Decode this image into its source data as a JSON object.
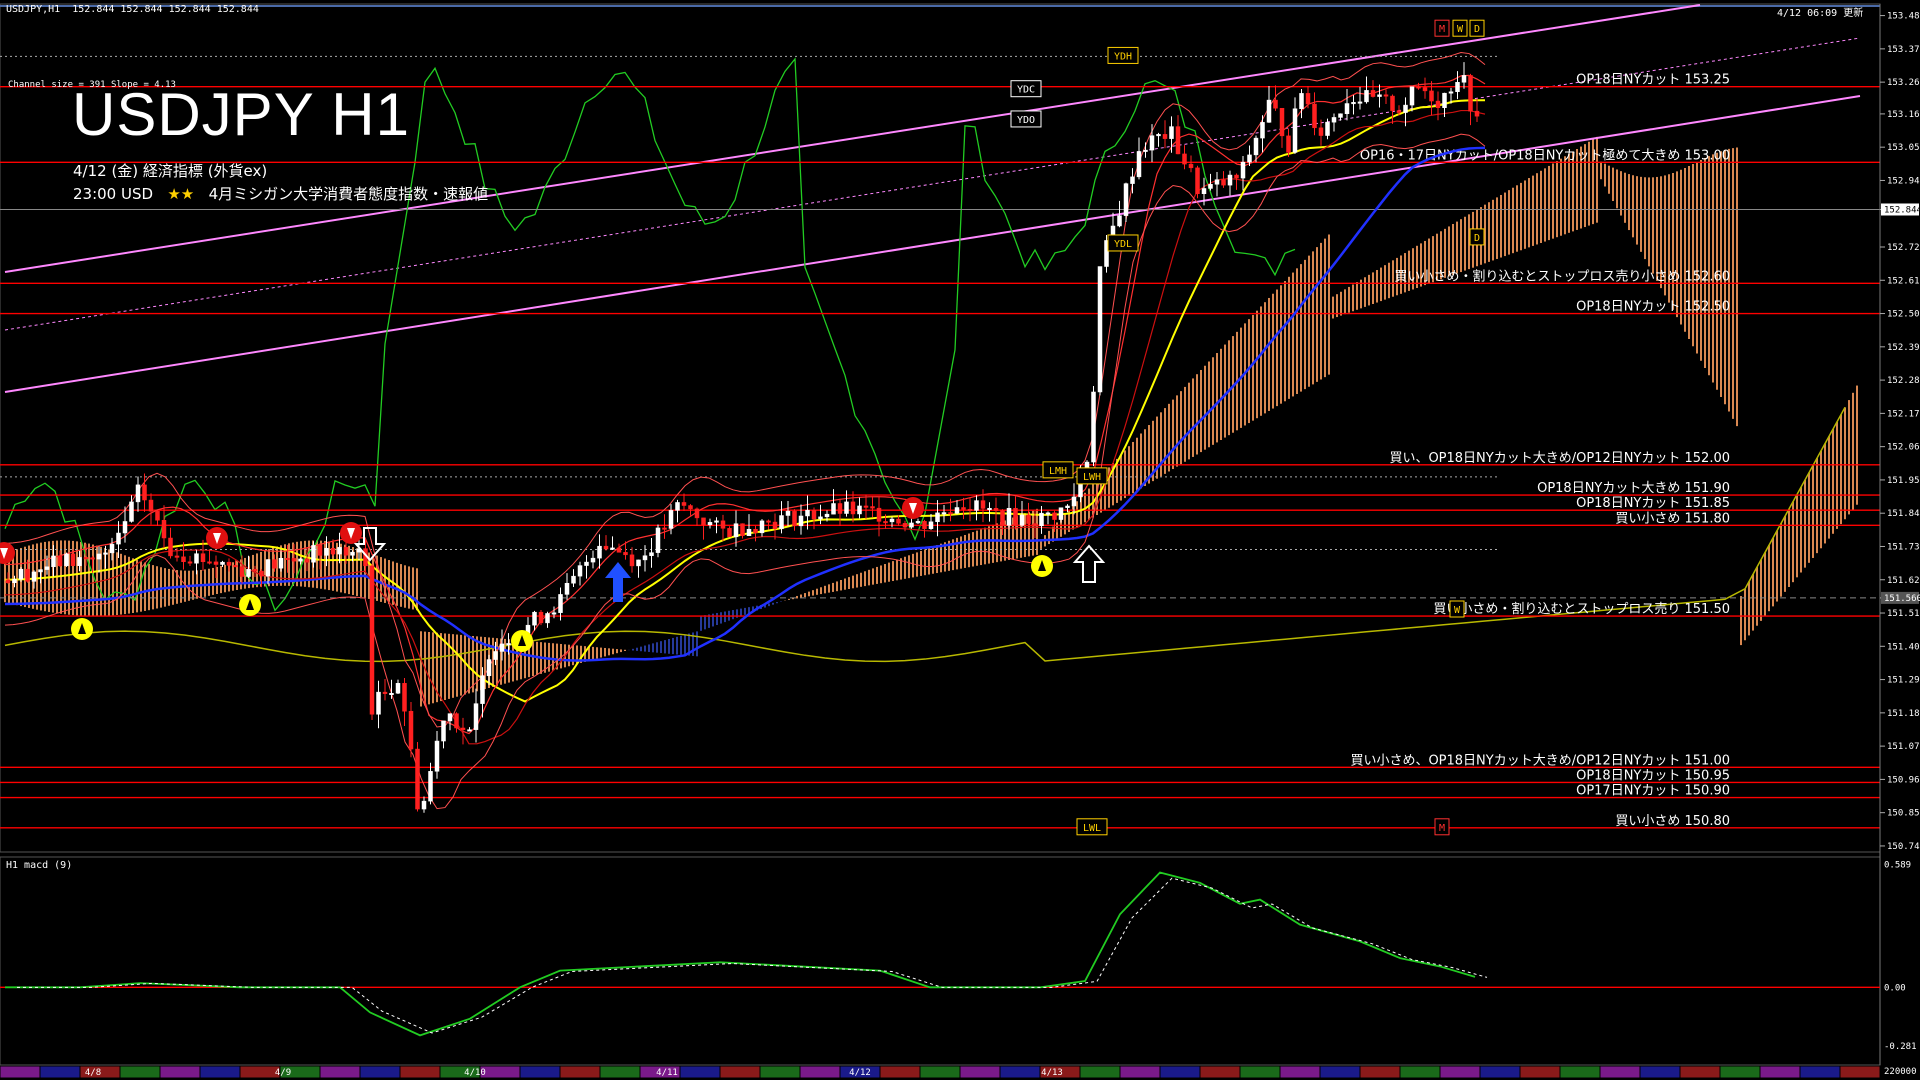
{
  "window_title": "USDJPY,H1",
  "ohlc_readout": "152.844 152.844 152.844 152.844",
  "update_stamp": "4/12 06:09 更新",
  "channel_info": "Channel size = 391 Slope = 4.13",
  "big_title": "USDJPY H1",
  "event_line1": "4/12 (金) 経済指標 (外貨ex)",
  "event_time": "23:00 USD",
  "event_stars": "★★",
  "event_desc": "4月ミシガン大学消費者態度指数・速報値",
  "macd_label": "H1  macd (9)",
  "current_price_tag": "152.844",
  "ask_price_tag": "151.560",
  "colors": {
    "bull_candle": "#ffffff",
    "bear_candle": "#ff2020",
    "level_line": "#ff0000",
    "channel": "#ff88ff",
    "kumo_up": "#ffa060",
    "kumo_down": "#4060ff",
    "ma_yellow": "#ffff00",
    "ma_blue": "#2030ff",
    "green_line": "#22cc22"
  },
  "chart_data": {
    "type": "candlestick",
    "symbol": "USDJPY",
    "timeframe": "H1",
    "y_axis_ticks": [
      "153.485",
      "153.375",
      "153.265",
      "153.160",
      "153.050",
      "152.940",
      "152.844",
      "152.720",
      "152.610",
      "152.500",
      "152.390",
      "152.280",
      "152.170",
      "152.060",
      "151.950",
      "151.840",
      "151.730",
      "151.620",
      "151.560",
      "151.510",
      "151.400",
      "151.290",
      "151.180",
      "151.070",
      "150.960",
      "150.850",
      "150.740"
    ],
    "ylim": [
      150.72,
      153.52
    ],
    "x_date_labels": [
      "4/8",
      "4/9",
      "4/10",
      "4/11",
      "4/12",
      "4/13"
    ],
    "price_levels": [
      {
        "price": 153.25,
        "label": "OP18日NYカット 153.25"
      },
      {
        "price": 153.0,
        "label": "OP16・17日NYカット/OP18日NYカット極めて大きめ 153.00"
      },
      {
        "price": 152.6,
        "label": "買い小さめ・割り込むとストップロス売り小さめ 152.60"
      },
      {
        "price": 152.5,
        "label": "OP18日NYカット 152.50"
      },
      {
        "price": 152.0,
        "label": "買い、OP18日NYカット大きめ/OP12日NYカット 152.00"
      },
      {
        "price": 151.9,
        "label": "OP18日NYカット大きめ 151.90"
      },
      {
        "price": 151.85,
        "label": "OP18日NYカット 151.85"
      },
      {
        "price": 151.8,
        "label": "買い小さめ 151.80"
      },
      {
        "price": 151.5,
        "label": "買い小さめ・割り込むとストップロス売り 151.50"
      },
      {
        "price": 151.0,
        "label": "買い小さめ、OP18日NYカット大きめ/OP12日NYカット 151.00"
      },
      {
        "price": 150.95,
        "label": "OP18日NYカット 150.95"
      },
      {
        "price": 150.9,
        "label": "OP17日NYカット 150.90"
      },
      {
        "price": 150.8,
        "label": "買い小さめ 150.80"
      }
    ],
    "markers": [
      {
        "label": "YDH",
        "price": 153.35
      },
      {
        "label": "YDC",
        "price": 153.24
      },
      {
        "label": "YDO",
        "price": 153.14
      },
      {
        "label": "YDL",
        "price": 152.73
      },
      {
        "label": "LMH",
        "price": 151.98
      },
      {
        "label": "LWH",
        "price": 151.96
      },
      {
        "label": "LWL",
        "price": 150.8
      },
      {
        "label": "M",
        "price": 153.44
      },
      {
        "label": "W",
        "price": 153.44
      },
      {
        "label": "D",
        "price": 153.44
      },
      {
        "label": "D",
        "price": 152.75
      },
      {
        "label": "W",
        "price": 151.52
      },
      {
        "label": "M",
        "price": 150.8
      }
    ],
    "macd_axis": [
      "0.589",
      "0.00",
      "-0.281"
    ],
    "macd_ylim": [
      -0.3,
      0.6
    ],
    "bottom_right": "220000"
  }
}
